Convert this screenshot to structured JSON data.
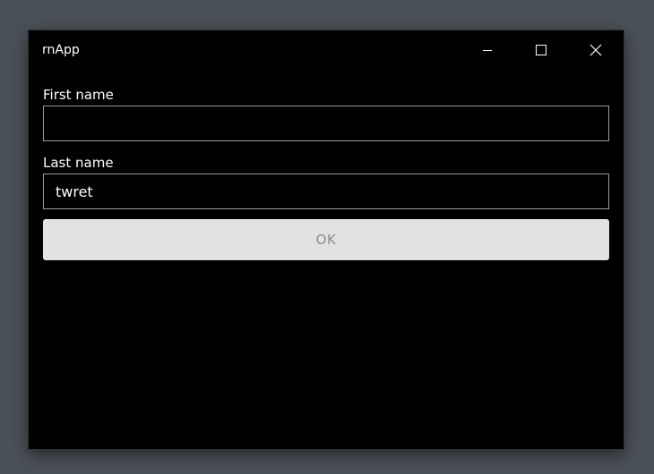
{
  "window": {
    "title": "rnApp"
  },
  "form": {
    "first_name_label": "First name",
    "first_name_value": "",
    "last_name_label": "Last name",
    "last_name_value": "twret",
    "ok_label": "OK"
  },
  "icons": {
    "minimize": "minimize-icon",
    "maximize": "maximize-icon",
    "close": "close-icon"
  },
  "colors": {
    "window_background": "#000000",
    "desktop_background": "#4a5157",
    "button_disabled_background": "#e2e2e2",
    "button_disabled_text": "#8c8c8c",
    "input_border": "#9a9a9a"
  }
}
